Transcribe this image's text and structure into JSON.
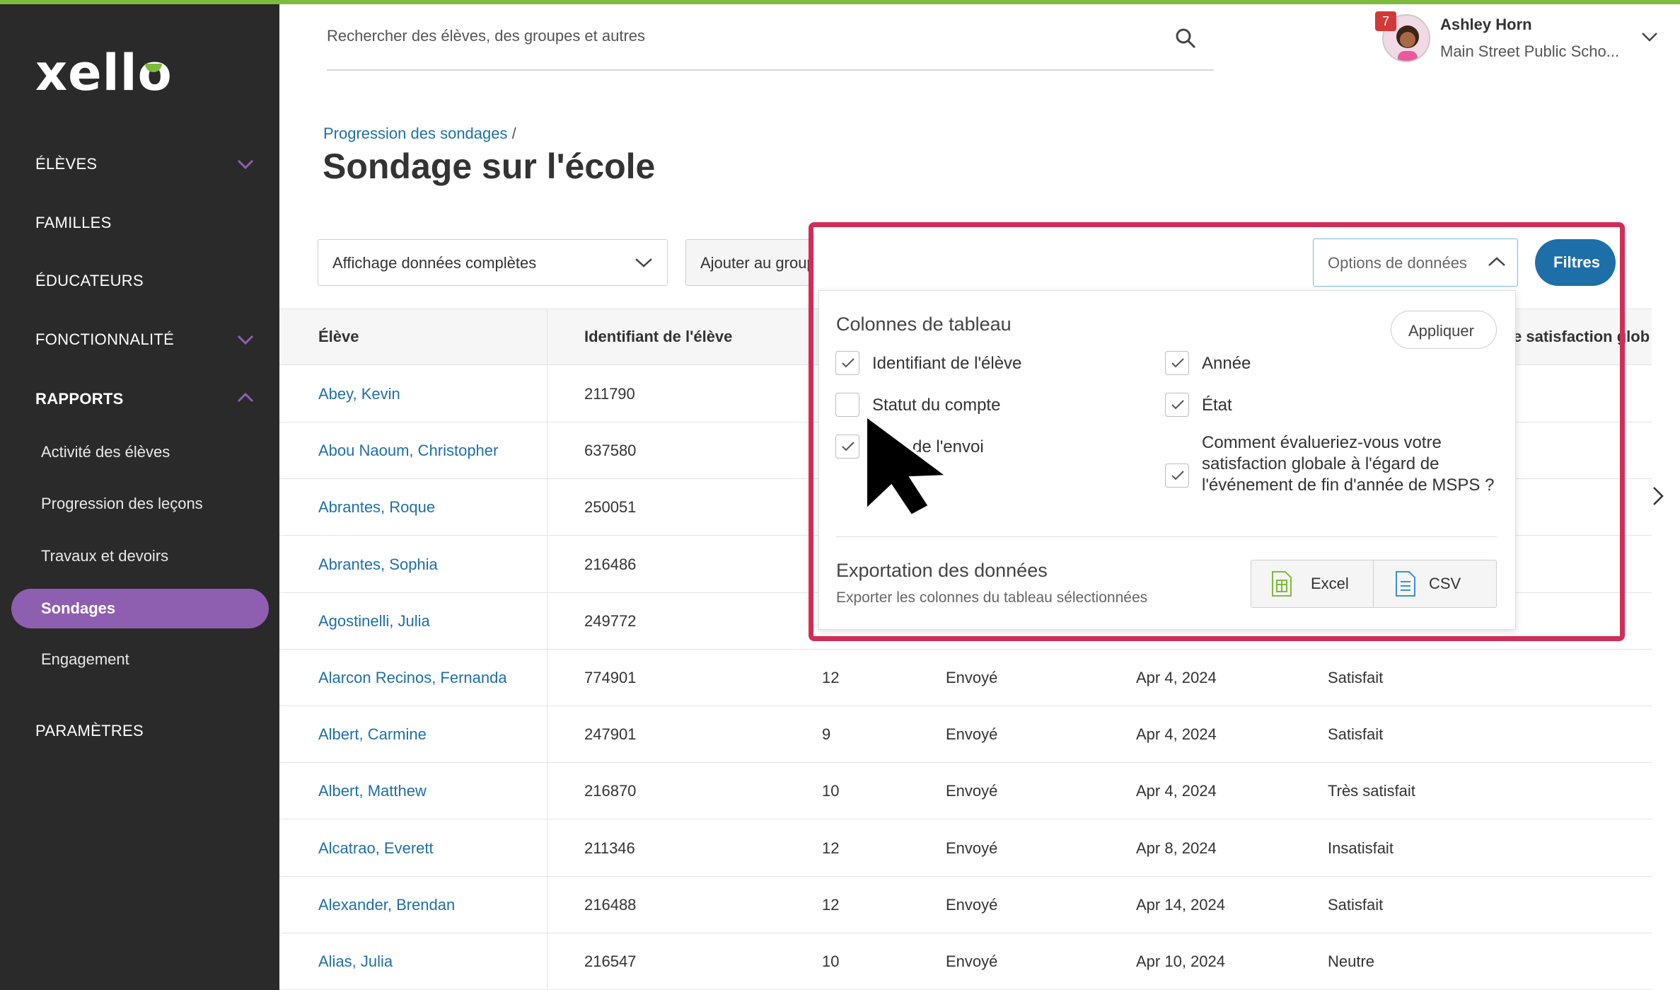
{
  "sidebar": {
    "logo": "xello",
    "items": [
      {
        "label": "ÉLÈVES"
      },
      {
        "label": "FAMILLES"
      },
      {
        "label": "ÉDUCATEURS"
      },
      {
        "label": "FONCTIONNALITÉ"
      },
      {
        "label": "RAPPORTS"
      },
      {
        "label": "PARAMÈTRES"
      }
    ],
    "sub_items": [
      {
        "label": "Activité des élèves"
      },
      {
        "label": "Progression des leçons"
      },
      {
        "label": "Travaux et devoirs"
      },
      {
        "label": "Sondages"
      },
      {
        "label": "Engagement"
      }
    ]
  },
  "header": {
    "search_placeholder": "Rechercher des élèves, des groupes et autres",
    "notification_count": "7",
    "user_name": "Ashley Horn",
    "user_school": "Main Street Public Scho..."
  },
  "page": {
    "breadcrumb": "Progression des sondages",
    "breadcrumb_sep": "/",
    "title": "Sondage sur l'école"
  },
  "toolbar": {
    "view_select": "Affichage données complètes",
    "add_group": "Ajouter au groupe",
    "data_options": "Options de données",
    "filters": "Filtres"
  },
  "panel": {
    "columns_title": "Colonnes de tableau",
    "apply": "Appliquer",
    "options": [
      {
        "label": "Identifiant de l'élève",
        "checked": true
      },
      {
        "label": "Année",
        "checked": true
      },
      {
        "label": "Statut du compte",
        "checked": false
      },
      {
        "label": "État",
        "checked": true
      },
      {
        "label": "de l'envoi",
        "checked": true
      },
      {
        "label": "Comment évalueriez-vous votre satisfaction globale à l'égard de l'événement de fin d'année de MSPS ?",
        "checked": true
      }
    ],
    "export_title": "Exportation des données",
    "export_sub": "Exporter les colonnes du tableau sélectionnées",
    "excel": "Excel",
    "csv": "CSV"
  },
  "table": {
    "headers": [
      "Élève",
      "Identifiant de l'élève",
      "e satisfaction glob"
    ],
    "rows": [
      {
        "name": "Abey, Kevin",
        "id": "211790",
        "grade": "",
        "status": "",
        "date": "",
        "satisfaction": ""
      },
      {
        "name": "Abou Naoum, Christopher",
        "id": "637580",
        "grade": "",
        "status": "",
        "date": "",
        "satisfaction": ""
      },
      {
        "name": "Abrantes, Roque",
        "id": "250051",
        "grade": "",
        "status": "",
        "date": "",
        "satisfaction": ""
      },
      {
        "name": "Abrantes, Sophia",
        "id": "216486",
        "grade": "",
        "status": "",
        "date": "",
        "satisfaction": ""
      },
      {
        "name": "Agostinelli, Julia",
        "id": "249772",
        "grade": "",
        "status": "",
        "date": "",
        "satisfaction": ""
      },
      {
        "name": "Alarcon Recinos, Fernanda",
        "id": "774901",
        "grade": "12",
        "status": "Envoyé",
        "date": "Apr 4, 2024",
        "satisfaction": "Satisfait"
      },
      {
        "name": "Albert, Carmine",
        "id": "247901",
        "grade": "9",
        "status": "Envoyé",
        "date": "Apr 4, 2024",
        "satisfaction": "Satisfait"
      },
      {
        "name": "Albert, Matthew",
        "id": "216870",
        "grade": "10",
        "status": "Envoyé",
        "date": "Apr 4, 2024",
        "satisfaction": "Très satisfait"
      },
      {
        "name": "Alcatrao, Everett",
        "id": "211346",
        "grade": "12",
        "status": "Envoyé",
        "date": "Apr 8, 2024",
        "satisfaction": "Insatisfait"
      },
      {
        "name": "Alexander, Brendan",
        "id": "216488",
        "grade": "12",
        "status": "Envoyé",
        "date": "Apr 14, 2024",
        "satisfaction": "Satisfait"
      },
      {
        "name": "Alias, Julia",
        "id": "216547",
        "grade": "10",
        "status": "Envoyé",
        "date": "Apr 10, 2024",
        "satisfaction": "Neutre"
      }
    ]
  },
  "colors": {
    "brand_green": "#7dbb3c",
    "sidebar_bg": "#2a2a2a",
    "active_purple": "#8e5fb0",
    "link_blue": "#1f6fa6",
    "primary_button": "#1e6fa8",
    "highlight_red": "#d12d57"
  }
}
